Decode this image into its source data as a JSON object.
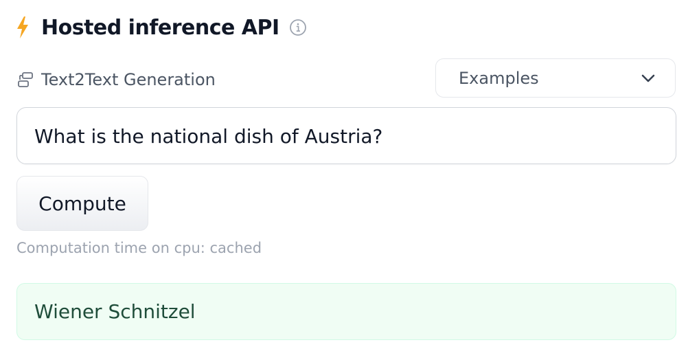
{
  "header": {
    "title": "Hosted inference API",
    "bolt_icon": "lightning-bolt-icon",
    "info_icon": "info-icon"
  },
  "task": {
    "icon": "text2text-generation-icon",
    "label": "Text2Text Generation"
  },
  "examples": {
    "label": "Examples",
    "icon": "chevron-down-icon"
  },
  "input": {
    "value": "What is the national dish of Austria?"
  },
  "compute": {
    "label": "Compute"
  },
  "status": {
    "computation_time": "Computation time on cpu: cached"
  },
  "output": {
    "text": "Wiener Schnitzel"
  },
  "colors": {
    "bolt": "#f5a623",
    "output_bg": "#f0fdf4",
    "output_border": "#d1fae5",
    "output_text": "#1f4d3a",
    "muted_text": "#9ca3af"
  }
}
